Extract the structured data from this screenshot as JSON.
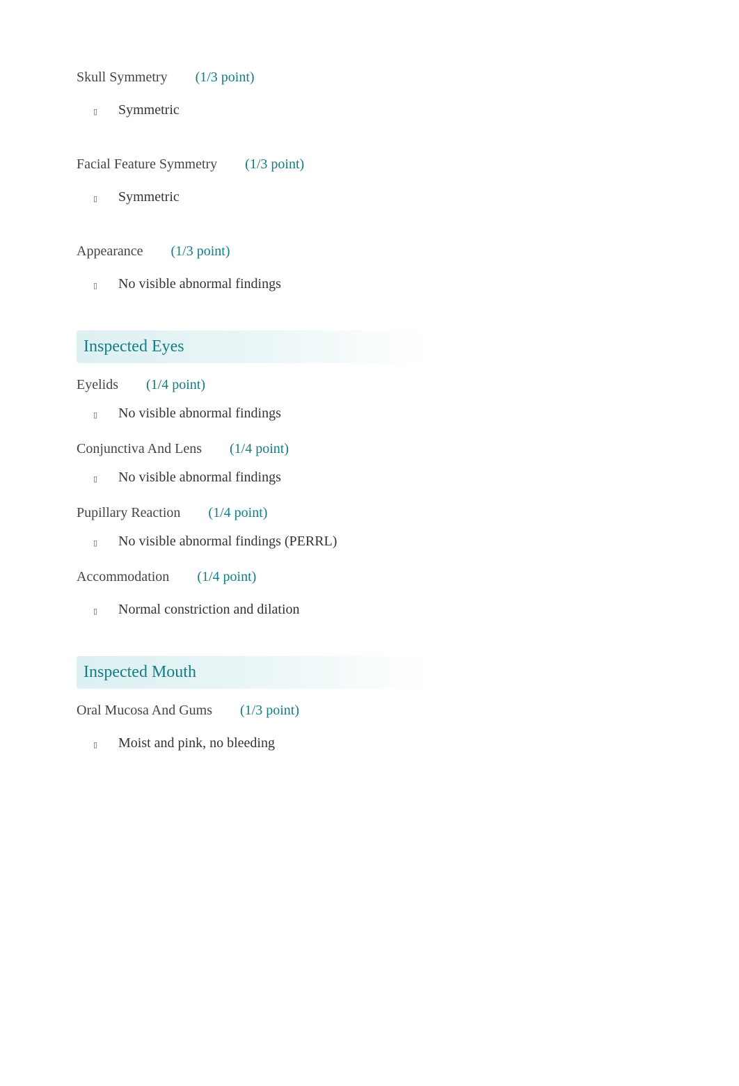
{
  "groups": [
    {
      "header": null,
      "items": [
        {
          "label": "Skull Symmetry",
          "points": "(1/3 point)",
          "finding": "Symmetric",
          "tight": false
        },
        {
          "label": "Facial Feature Symmetry",
          "points": "(1/3 point)",
          "finding": "Symmetric",
          "tight": false
        },
        {
          "label": "Appearance",
          "points": "(1/3 point)",
          "finding": "No visible abnormal findings",
          "tight": false
        }
      ]
    },
    {
      "header": "Inspected Eyes",
      "items": [
        {
          "label": "Eyelids",
          "points": "(1/4 point)",
          "finding": "No visible abnormal findings",
          "tight": true
        },
        {
          "label": "Conjunctiva And Lens",
          "points": "(1/4 point)",
          "finding": "No visible abnormal findings",
          "tight": true
        },
        {
          "label": "Pupillary Reaction",
          "points": "(1/4 point)",
          "finding": "No visible abnormal findings (PERRL)",
          "tight": true
        },
        {
          "label": "Accommodation",
          "points": "(1/4 point)",
          "finding": "Normal constriction and dilation",
          "tight": false
        }
      ]
    },
    {
      "header": "Inspected Mouth",
      "items": [
        {
          "label": "Oral Mucosa And Gums",
          "points": "(1/3 point)",
          "finding": "Moist and pink, no bleeding",
          "tight": false
        }
      ]
    }
  ]
}
